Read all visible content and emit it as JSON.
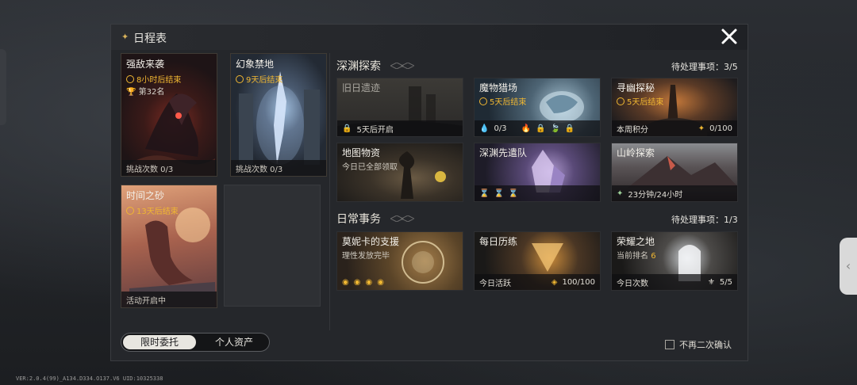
{
  "panel": {
    "title": "日程表"
  },
  "left_cards": [
    {
      "name": "强敌来袭",
      "timer": "8小时后结束",
      "rank": "第32名",
      "footer": "挑战次数 0/3"
    },
    {
      "name": "幻象禁地",
      "timer": "9天后结束",
      "footer": "挑战次数 0/3"
    },
    {
      "name": "时间之砂",
      "timer": "13天后结束",
      "footer": "活动开启中"
    }
  ],
  "abyss": {
    "title": "深渊探索",
    "pending_label": "待处理事项：3/5",
    "cards": [
      {
        "name": "旧日遗迹",
        "footer": "5天后开启"
      },
      {
        "name": "魔物猎场",
        "timer": "5天后结束",
        "footer_value": "0/3"
      },
      {
        "name": "寻幽探秘",
        "timer": "5天后结束",
        "footer_left": "本周积分",
        "footer_right": "0/100"
      },
      {
        "name": "地图物资",
        "sub": "今日已全部领取"
      },
      {
        "name": "深渊先遣队"
      },
      {
        "name": "山岭探索",
        "footer": "23分钟/24小时"
      }
    ]
  },
  "daily": {
    "title": "日常事务",
    "pending_label": "待处理事项：1/3",
    "cards": [
      {
        "name": "莫妮卡的支援",
        "sub": "理性发放完毕"
      },
      {
        "name": "每日历练",
        "footer_left": "今日活跃",
        "footer_right": "100/100"
      },
      {
        "name": "荣耀之地",
        "sub_label": "当前排名",
        "sub_value": "6",
        "footer_left": "今日次数",
        "footer_right": "5/5"
      }
    ]
  },
  "toggle": {
    "active": "限时委托",
    "inactive": "个人资产"
  },
  "confirm_label": "不再二次确认",
  "version": "VER:2.0.4(99)_A134.D334.O137.V6   UID:10325338",
  "colors": {
    "accent_gold": "#f0b732",
    "panel_bg": "#25272b"
  }
}
